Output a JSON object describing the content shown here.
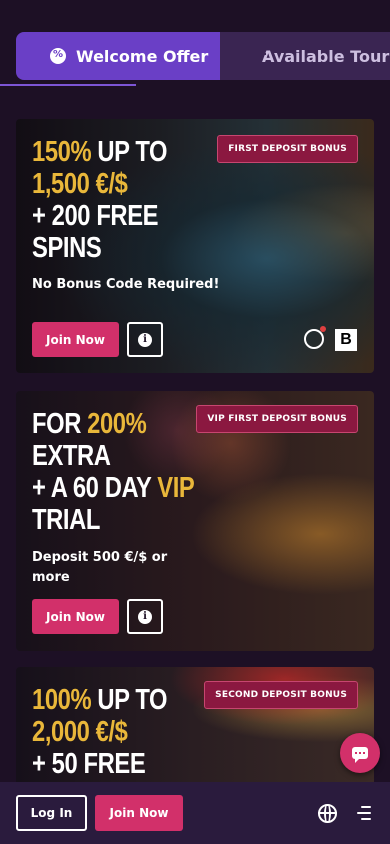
{
  "tabs": [
    {
      "label": "Welcome Offer",
      "icon": "percent-badge-icon",
      "active": true
    },
    {
      "label": "Available Tournaments",
      "icon": "calendar-icon",
      "active": false
    }
  ],
  "offers": [
    {
      "badge": "FIRST DEPOSIT BONUS",
      "headline": [
        {
          "text": "150%",
          "color": "#e9b73a"
        },
        {
          "text": " UP TO",
          "color": "#ffffff"
        },
        {
          "text": "1,500 €/$",
          "color": "#e9b73a"
        },
        {
          "text": "+ 200 FREE",
          "color": "#ffffff"
        },
        {
          "text": "SPINS",
          "color": "#ffffff"
        }
      ],
      "subtitle": "No Bonus Code Required!",
      "join_label": "Join Now",
      "info_icon": "info-icon",
      "providers": [
        "bomb-logo-icon",
        "b-logo-icon"
      ],
      "provider_b_text": "B"
    },
    {
      "badge": "VIP FIRST DEPOSIT BONUS",
      "headline": [
        {
          "text": "FOR ",
          "color": "#ffffff"
        },
        {
          "text": "200%",
          "color": "#e9b73a"
        },
        {
          "text": "EXTRA",
          "color": "#ffffff"
        },
        {
          "text": "+ A 60 DAY ",
          "color": "#ffffff"
        },
        {
          "text": "VIP",
          "color": "#e9b73a"
        },
        {
          "text": "TRIAL",
          "color": "#ffffff"
        }
      ],
      "subtitle": "Deposit 500 €/$ or more",
      "join_label": "Join Now",
      "info_icon": "info-icon"
    },
    {
      "badge": "SECOND DEPOSIT BONUS",
      "headline": [
        {
          "text": "100%",
          "color": "#e9b73a"
        },
        {
          "text": " UP TO",
          "color": "#ffffff"
        },
        {
          "text": "2,000 €/$",
          "color": "#e9b73a"
        },
        {
          "text": "+ 50 FREE",
          "color": "#ffffff"
        }
      ]
    }
  ],
  "chat_icon": "chat-bubble-icon",
  "bottom_bar": {
    "login_label": "Log In",
    "join_label": "Join Now",
    "globe_icon": "globe-icon",
    "menu_icon": "hamburger-menu-icon"
  },
  "colors": {
    "accent": "#d2306a",
    "tab_active": "#6a3fc6",
    "gold": "#e9b73a",
    "background": "#1d1025"
  }
}
